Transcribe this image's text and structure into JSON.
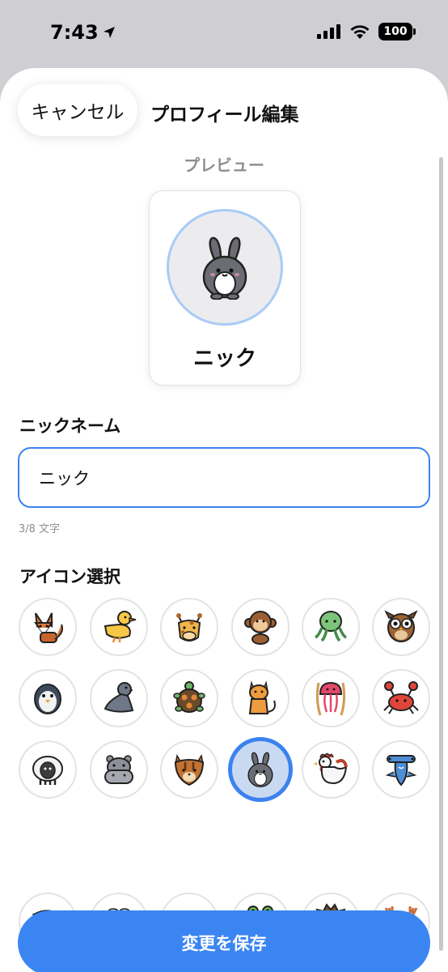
{
  "status": {
    "time": "7:43",
    "battery": "100"
  },
  "header": {
    "cancel_label": "キャンセル",
    "title": "プロフィール編集"
  },
  "preview": {
    "label": "プレビュー",
    "name": "ニック",
    "avatar_icon": "rabbit-icon"
  },
  "nickname": {
    "label": "ニックネーム",
    "value": "ニック",
    "char_count": "3/8 文字"
  },
  "icon_select": {
    "label": "アイコン選択",
    "selected": "rabbit",
    "icons": [
      [
        "fox",
        "duck",
        "giraffe",
        "monkey",
        "octopus",
        "owl"
      ],
      [
        "penguin",
        "seal",
        "turtle",
        "cat",
        "jellyfish",
        "crab"
      ],
      [
        "sheep",
        "hippo",
        "chipmunk",
        "rabbit",
        "rooster",
        "hammerhead-shark"
      ],
      [
        "eagle",
        "bee",
        "fish",
        "frog",
        "hedgehog",
        "moose"
      ]
    ]
  },
  "save_label": "変更を保存",
  "colors": {
    "accent": "#3b85f2",
    "selected_bg": "#c9d9f2",
    "secondary_text": "#8e8e93"
  }
}
